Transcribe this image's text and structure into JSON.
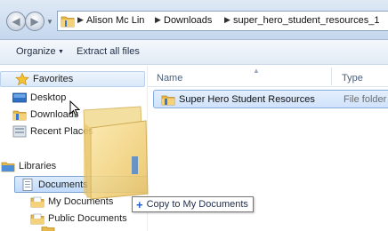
{
  "address_bar": {
    "breadcrumbs": [
      "Alison Mc Lin",
      "Downloads",
      "super_hero_student_resources_1"
    ]
  },
  "toolbar": {
    "organize_label": "Organize",
    "extract_label": "Extract all files"
  },
  "nav_pane": {
    "favorites_label": "Favorites",
    "desktop_label": "Desktop",
    "downloads_label": "Downloads",
    "recent_places_label": "Recent Places",
    "libraries_label": "Libraries",
    "documents_label": "Documents",
    "my_documents_label": "My Documents",
    "public_documents_label": "Public Documents"
  },
  "content": {
    "columns": {
      "name": "Name",
      "type": "Type"
    },
    "files": [
      {
        "name": "Super Hero Student Resources",
        "type": "File folder"
      }
    ]
  },
  "drag": {
    "tooltip": "Copy to My Documents"
  },
  "colors": {
    "selection_fill": "#cfe2fb",
    "selection_border": "#84acdd",
    "folder": "#f2c75a"
  }
}
